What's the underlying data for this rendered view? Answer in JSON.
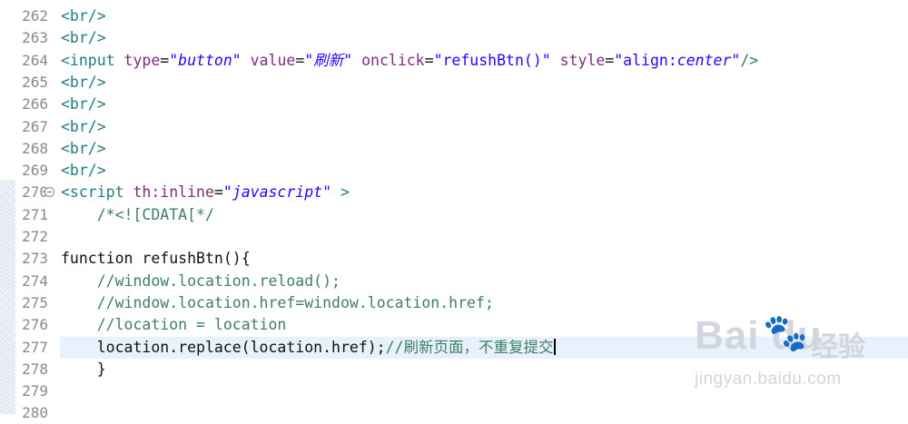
{
  "editor": {
    "lines": [
      {
        "num": "262",
        "html": "<span class=\"tag\">&lt;br/&gt;</span>"
      },
      {
        "num": "263",
        "html": "<span class=\"tag\">&lt;br/&gt;</span>"
      },
      {
        "num": "264",
        "html": "<span class=\"tag\">&lt;input</span> <span class=\"attr\">type</span>=<span class=\"val\">\"button\"</span> <span class=\"attr\">value</span>=<span class=\"val\">\"刷新\"</span> <span class=\"attr\">onclick</span>=<span class=\"valn\">\"refushBtn()\"</span> <span class=\"attr\">style</span>=<span class=\"valn\">\"align:<i>center</i>\"</span><span class=\"tag\">/&gt;</span>"
      },
      {
        "num": "265",
        "html": "<span class=\"tag\">&lt;br/&gt;</span>"
      },
      {
        "num": "266",
        "html": "<span class=\"tag\">&lt;br/&gt;</span>"
      },
      {
        "num": "267",
        "html": "<span class=\"tag\">&lt;br/&gt;</span>"
      },
      {
        "num": "268",
        "html": "<span class=\"tag\">&lt;br/&gt;</span>"
      },
      {
        "num": "269",
        "html": "<span class=\"tag\">&lt;br/&gt;</span>"
      },
      {
        "num": "270",
        "fold": true,
        "html": "<span class=\"tag\">&lt;script</span> <span class=\"attr\">th:inline</span>=<span class=\"val\">\"javascript\"</span> <span class=\"tag\">&gt;</span>"
      },
      {
        "num": "271",
        "html": "    <span class=\"com\">/*&lt;![CDATA[*/</span>"
      },
      {
        "num": "272",
        "html": ""
      },
      {
        "num": "273",
        "html": "<span class=\"kw\">function</span> refushBtn(){"
      },
      {
        "num": "274",
        "html": "    <span class=\"com\">//window.location.reload();</span>"
      },
      {
        "num": "275",
        "html": "    <span class=\"com\">//window.location.href=window.location.href;</span>"
      },
      {
        "num": "276",
        "html": "    <span class=\"com\">//location = location</span>"
      },
      {
        "num": "277",
        "current": true,
        "html": "    location.replace(location.href);<span class=\"com\">//刷新页面，不重复提交</span><span class=\"caret\"></span>"
      },
      {
        "num": "278",
        "html": "    }"
      },
      {
        "num": "279",
        "html": ""
      },
      {
        "num": "280",
        "html": ""
      }
    ]
  },
  "watermark": {
    "logo": "Bai du",
    "brand": "经验",
    "url": "jingyan.baidu.com"
  }
}
